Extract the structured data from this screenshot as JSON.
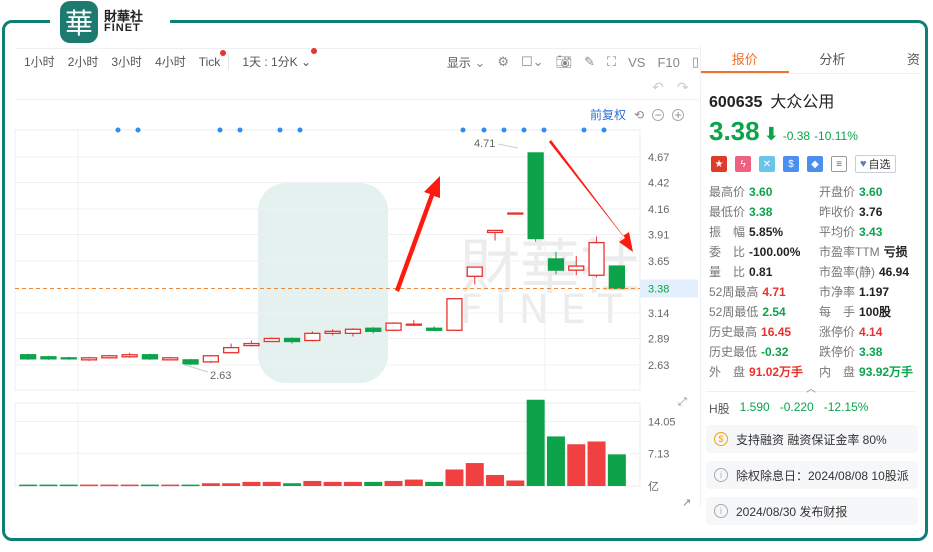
{
  "brand": {
    "mark": "華",
    "cn": "財華社",
    "en": "FINET"
  },
  "toolbar": {
    "periods": [
      "1小时",
      "2小时",
      "3小时",
      "4小时",
      "Tick"
    ],
    "day_select": "1天 : 1分K",
    "display_label": "显示",
    "vs_label": "VS",
    "f10_label": "F10"
  },
  "adjust_label": "前复权",
  "accent": {
    "up": "#e8322e",
    "down": "#0ca34a",
    "brand": "#0d7f77",
    "tab": "#f0712d"
  },
  "quote": {
    "tabs": [
      "报价",
      "分析",
      "资"
    ],
    "code": "600635",
    "name": "大众公用",
    "price": "3.38",
    "change": "-0.38",
    "change_pct": "-10.11%",
    "watch_label": "自选",
    "fields": [
      {
        "k": "最高价",
        "v": "3.60",
        "c": "green"
      },
      {
        "k": "开盘价",
        "v": "3.60",
        "c": "green"
      },
      {
        "k": "最低价",
        "v": "3.38",
        "c": "green"
      },
      {
        "k": "昨收价",
        "v": "3.76",
        "c": "dark"
      },
      {
        "k": "振　幅",
        "v": "5.85%",
        "c": "dark"
      },
      {
        "k": "平均价",
        "v": "3.43",
        "c": "green"
      },
      {
        "k": "委　比",
        "v": "-100.00%",
        "c": "dark"
      },
      {
        "k": "市盈率TTM",
        "v": "亏损",
        "c": "dark"
      },
      {
        "k": "量　比",
        "v": "0.81",
        "c": "dark"
      },
      {
        "k": "市盈率(静)",
        "v": "46.94",
        "c": "dark"
      },
      {
        "k": "52周最高",
        "v": "4.71",
        "c": "red"
      },
      {
        "k": "市净率",
        "v": "1.197",
        "c": "dark"
      },
      {
        "k": "52周最低",
        "v": "2.54",
        "c": "green"
      },
      {
        "k": "每　手",
        "v": "100股",
        "c": "dark"
      },
      {
        "k": "历史最高",
        "v": "16.45",
        "c": "red"
      },
      {
        "k": "涨停价",
        "v": "4.14",
        "c": "red"
      },
      {
        "k": "历史最低",
        "v": "-0.32",
        "c": "green"
      },
      {
        "k": "跌停价",
        "v": "3.38",
        "c": "green"
      },
      {
        "k": "外　盘",
        "v": "91.02万手",
        "c": "red"
      },
      {
        "k": "内　盘",
        "v": "93.92万手",
        "c": "green"
      }
    ],
    "h_share": {
      "label": "H股",
      "price": "1.590",
      "change": "-0.220",
      "pct": "-12.15%"
    },
    "notices": [
      {
        "icon": "dollar-icon",
        "text": "支持融资 融资保证金率 80%"
      },
      {
        "icon": "info-icon",
        "text": "除权除息日：2024/08/08  10股派"
      },
      {
        "icon": "info-icon",
        "text": "2024/08/30  发布财报"
      }
    ]
  },
  "chart_data": {
    "type": "candlestick",
    "price_axis": {
      "ticks": [
        "4.67",
        "4.42",
        "4.16",
        "3.91",
        "3.65",
        "3.14",
        "2.89",
        "2.63"
      ],
      "ylim": [
        2.45,
        4.9
      ],
      "current": "3.38"
    },
    "volume_axis": {
      "ticks": [
        "14.05",
        "7.13"
      ],
      "unit": "亿",
      "ylim": [
        0,
        17
      ]
    },
    "annotations": {
      "high_label": "4.71",
      "low_label": "2.63"
    },
    "candles": [
      {
        "o": 2.73,
        "c": 2.69,
        "h": 2.74,
        "l": 2.68,
        "v": 0.3
      },
      {
        "o": 2.71,
        "c": 2.69,
        "h": 2.72,
        "l": 2.68,
        "v": 0.3
      },
      {
        "o": 2.7,
        "c": 2.69,
        "h": 2.71,
        "l": 2.68,
        "v": 0.3
      },
      {
        "o": 2.68,
        "c": 2.7,
        "h": 2.71,
        "l": 2.67,
        "v": 0.3
      },
      {
        "o": 2.7,
        "c": 2.72,
        "h": 2.73,
        "l": 2.7,
        "v": 0.3
      },
      {
        "o": 2.71,
        "c": 2.73,
        "h": 2.75,
        "l": 2.7,
        "v": 0.3
      },
      {
        "o": 2.73,
        "c": 2.69,
        "h": 2.74,
        "l": 2.68,
        "v": 0.3
      },
      {
        "o": 2.68,
        "c": 2.7,
        "h": 2.71,
        "l": 2.68,
        "v": 0.3
      },
      {
        "o": 2.68,
        "c": 2.64,
        "h": 2.69,
        "l": 2.63,
        "v": 0.3
      },
      {
        "o": 2.66,
        "c": 2.72,
        "h": 2.73,
        "l": 2.65,
        "v": 0.6
      },
      {
        "o": 2.75,
        "c": 2.8,
        "h": 2.84,
        "l": 2.75,
        "v": 0.6
      },
      {
        "o": 2.82,
        "c": 2.84,
        "h": 2.87,
        "l": 2.81,
        "v": 0.9
      },
      {
        "o": 2.86,
        "c": 2.89,
        "h": 2.9,
        "l": 2.86,
        "v": 0.9
      },
      {
        "o": 2.89,
        "c": 2.86,
        "h": 2.9,
        "l": 2.84,
        "v": 0.6
      },
      {
        "o": 2.87,
        "c": 2.94,
        "h": 2.96,
        "l": 2.86,
        "v": 1.1
      },
      {
        "o": 2.94,
        "c": 2.96,
        "h": 2.98,
        "l": 2.92,
        "v": 0.9
      },
      {
        "o": 2.94,
        "c": 2.98,
        "h": 2.99,
        "l": 2.91,
        "v": 0.9
      },
      {
        "o": 2.99,
        "c": 2.96,
        "h": 3.0,
        "l": 2.94,
        "v": 0.9
      },
      {
        "o": 2.97,
        "c": 3.04,
        "h": 3.05,
        "l": 2.96,
        "v": 1.1
      },
      {
        "o": 3.03,
        "c": 3.03,
        "h": 3.07,
        "l": 3.01,
        "v": 1.4
      },
      {
        "o": 2.99,
        "c": 2.97,
        "h": 3.01,
        "l": 2.96,
        "v": 0.9
      },
      {
        "o": 2.97,
        "c": 3.28,
        "h": 3.28,
        "l": 2.97,
        "v": 3.6
      },
      {
        "o": 3.5,
        "c": 3.59,
        "h": 3.59,
        "l": 3.42,
        "v": 5.0
      },
      {
        "o": 3.93,
        "c": 3.95,
        "h": 3.95,
        "l": 3.85,
        "v": 2.4
      },
      {
        "o": 4.12,
        "c": 4.12,
        "h": 4.12,
        "l": 4.12,
        "v": 1.2
      },
      {
        "o": 4.71,
        "c": 3.87,
        "h": 4.71,
        "l": 3.84,
        "v": 18.8
      },
      {
        "o": 3.67,
        "c": 3.56,
        "h": 3.74,
        "l": 3.52,
        "v": 10.8
      },
      {
        "o": 3.56,
        "c": 3.6,
        "h": 3.7,
        "l": 3.51,
        "v": 9.1
      },
      {
        "o": 3.51,
        "c": 3.83,
        "h": 3.89,
        "l": 3.49,
        "v": 9.7
      },
      {
        "o": 3.6,
        "c": 3.38,
        "h": 3.6,
        "l": 3.38,
        "v": 6.9
      }
    ],
    "event_markers_count": 12
  }
}
